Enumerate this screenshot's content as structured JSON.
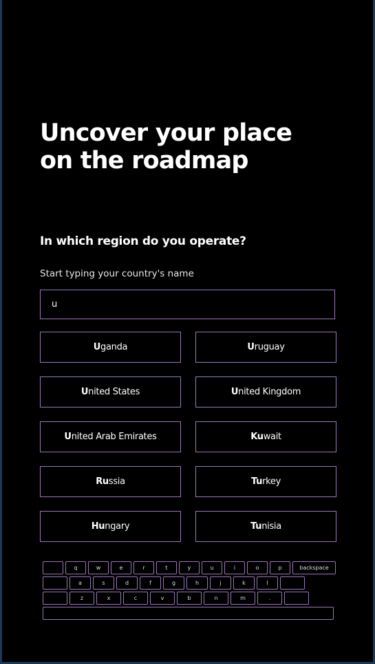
{
  "headline": "Uncover your place\non the roadmap",
  "question": "In which region do you operate?",
  "hint": "Start typing your country's name",
  "search": {
    "value": "u"
  },
  "options": [
    {
      "match": "U",
      "rest": "ganda"
    },
    {
      "match": "U",
      "rest": "ruguay"
    },
    {
      "match": "U",
      "rest": "nited States"
    },
    {
      "match": "U",
      "rest": "nited Kingdom"
    },
    {
      "match": "U",
      "rest": "nited Arab Emirates"
    },
    {
      "match": "Ku",
      "rest": "wait"
    },
    {
      "match": "Ru",
      "rest": "ssia"
    },
    {
      "match": "Tu",
      "rest": "rkey"
    },
    {
      "match": "Hu",
      "rest": "ngary"
    },
    {
      "match": "Tu",
      "rest": "nisia"
    }
  ],
  "keyboard": {
    "row1": [
      "",
      "q",
      "w",
      "e",
      "r",
      "t",
      "y",
      "u",
      "i",
      "o",
      "p",
      "backspace"
    ],
    "row2": [
      "",
      "a",
      "s",
      "d",
      "f",
      "g",
      "h",
      "j",
      "k",
      "l",
      ""
    ],
    "row3": [
      "",
      "z",
      "x",
      "c",
      "v",
      "b",
      "n",
      "m",
      ".",
      ""
    ],
    "space": ""
  }
}
